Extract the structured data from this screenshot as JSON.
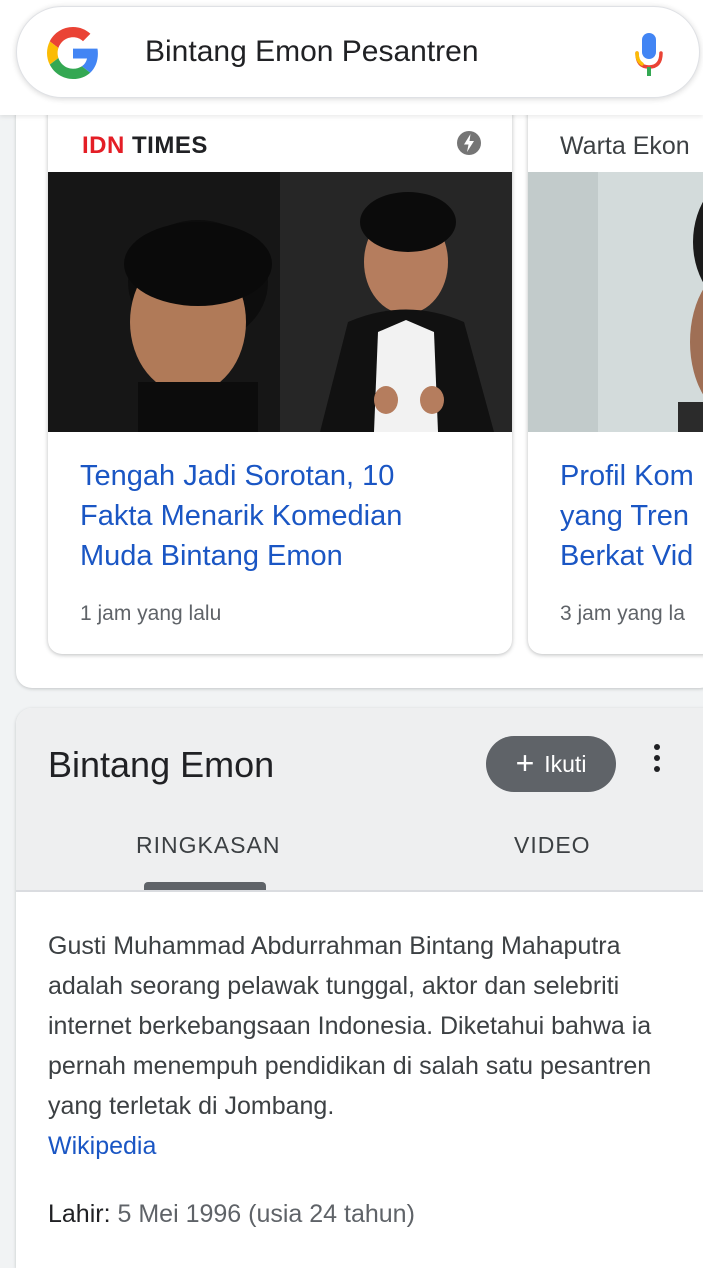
{
  "search": {
    "query": "Bintang Emon Pesantren"
  },
  "top_stories": [
    {
      "publisher_red": "IDN",
      "publisher_dark": "TIMES",
      "headline": "Tengah Jadi Sorotan, 10 Fakta Menarik Komedian Muda Bintang Emon",
      "time": "1 jam yang lalu",
      "amp_icon": "amp-bolt-icon"
    },
    {
      "publisher": "Warta Ekon",
      "headline_lines": [
        "Profil Kom",
        "yang Tren",
        "Berkat Vid"
      ],
      "time": "3 jam yang la"
    }
  ],
  "knowledge_panel": {
    "title": "Bintang Emon",
    "follow_label": "Ikuti",
    "tabs": [
      "RINGKASAN",
      "VIDEO"
    ],
    "active_tab": "RINGKASAN",
    "description": "Gusti Muhammad Abdurrahman Bintang Mahaputra adalah seorang pelawak tunggal, aktor dan selebriti internet berkebangsaan Indonesia. Diketahui bahwa ia pernah menempuh pendidikan di salah satu pesantren yang terletak di Jombang.",
    "source_link": "Wikipedia",
    "born_label": "Lahir:",
    "born_value": "5 Mei 1996 (usia 24 tahun)"
  },
  "colors": {
    "link_blue": "#1a56c4",
    "idn_red": "#e41e26",
    "follow_button": "#5f6368"
  }
}
